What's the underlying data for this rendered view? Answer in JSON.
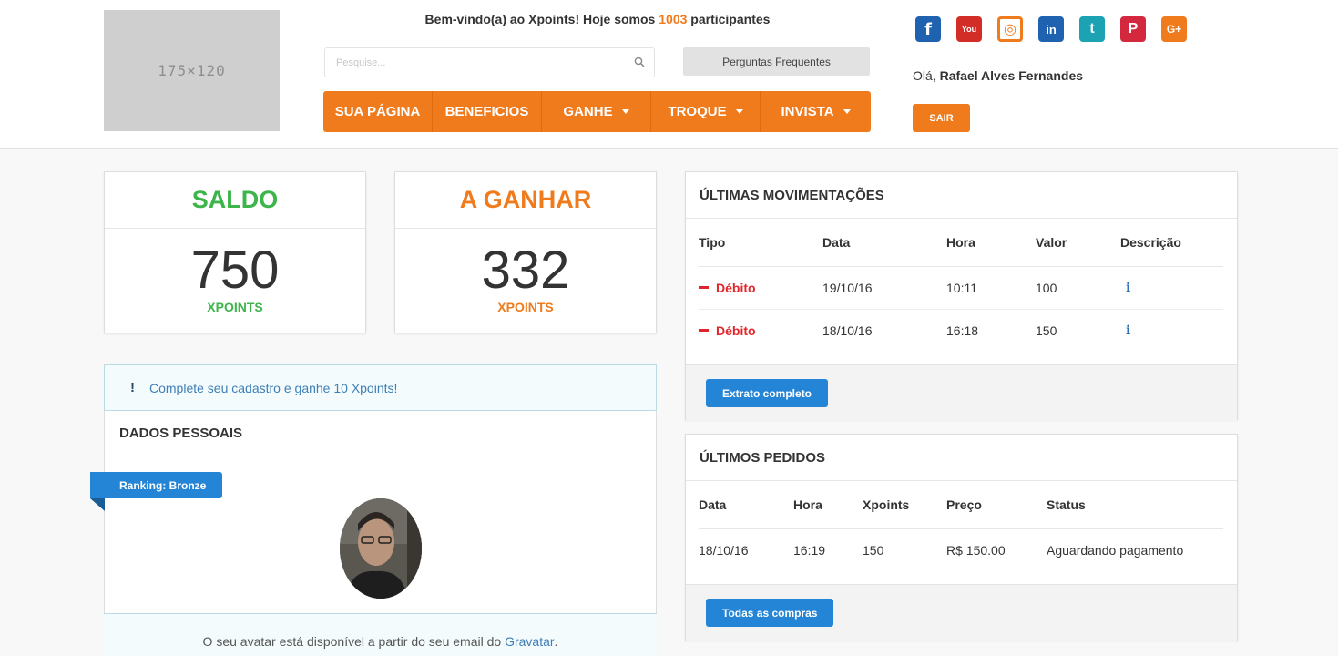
{
  "header": {
    "logo_text": "175×120",
    "welcome_prefix": "Bem-vindo(a) ao Xpoints! Hoje somos ",
    "participant_count": "1003",
    "welcome_suffix": " participantes",
    "search_placeholder": "Pesquise...",
    "faq_label": "Perguntas Frequentes",
    "nav": [
      {
        "label": "SUA PÁGINA",
        "dropdown": false
      },
      {
        "label": "BENEFICIOS",
        "dropdown": false
      },
      {
        "label": "GANHE",
        "dropdown": true
      },
      {
        "label": "TROQUE",
        "dropdown": true
      },
      {
        "label": "INVISTA",
        "dropdown": true
      }
    ],
    "social": [
      {
        "icon": "facebook-icon",
        "glyph": "f",
        "color": "#1f63b0"
      },
      {
        "icon": "youtube-icon",
        "glyph": "You",
        "color": "#d32d27"
      },
      {
        "icon": "instagram-icon",
        "glyph": "◎",
        "color": "#f07b1d"
      },
      {
        "icon": "linkedin-icon",
        "glyph": "in",
        "color": "#1f63b0"
      },
      {
        "icon": "twitter-icon",
        "glyph": "t",
        "color": "#1ba3b4"
      },
      {
        "icon": "pinterest-icon",
        "glyph": "P",
        "color": "#d3283e"
      },
      {
        "icon": "google-plus-icon",
        "glyph": "G+",
        "color": "#f07b1d"
      }
    ],
    "greeting": "Olá, ",
    "user_name": "Rafael Alves Fernandes",
    "logout_label": "SAIR"
  },
  "balance": {
    "title": "SALDO",
    "value": "750",
    "unit": "XPOINTS",
    "color": "#3cb54a"
  },
  "pending": {
    "title": "A GANHAR",
    "value": "332",
    "unit": "XPOINTS",
    "color": "#f07b1d"
  },
  "personal": {
    "alert_icon": "!",
    "alert_text": "Complete seu cadastro e ganhe 10 Xpoints!",
    "title": "DADOS PESSOAIS",
    "ranking": "Ranking: Bronze",
    "gravatar_prefix": "O seu avatar está disponível a partir do seu email do ",
    "gravatar_link": "Gravatar",
    "gravatar_suffix": "."
  },
  "movements": {
    "title": "ÚLTIMAS MOVIMENTAÇÕES",
    "columns": [
      "Tipo",
      "Data",
      "Hora",
      "Valor",
      "Descrição"
    ],
    "rows": [
      {
        "type": "Débito",
        "date": "19/10/16",
        "time": "10:11",
        "value": "100"
      },
      {
        "type": "Débito",
        "date": "18/10/16",
        "time": "16:18",
        "value": "150"
      }
    ],
    "button": "Extrato completo"
  },
  "orders": {
    "title": "ÚLTIMOS PEDIDOS",
    "columns": [
      "Data",
      "Hora",
      "Xpoints",
      "Preço",
      "Status"
    ],
    "rows": [
      {
        "date": "18/10/16",
        "time": "16:19",
        "xpoints": "150",
        "price": "R$ 150.00",
        "status": "Aguardando pagamento"
      }
    ],
    "button": "Todas as compras"
  }
}
